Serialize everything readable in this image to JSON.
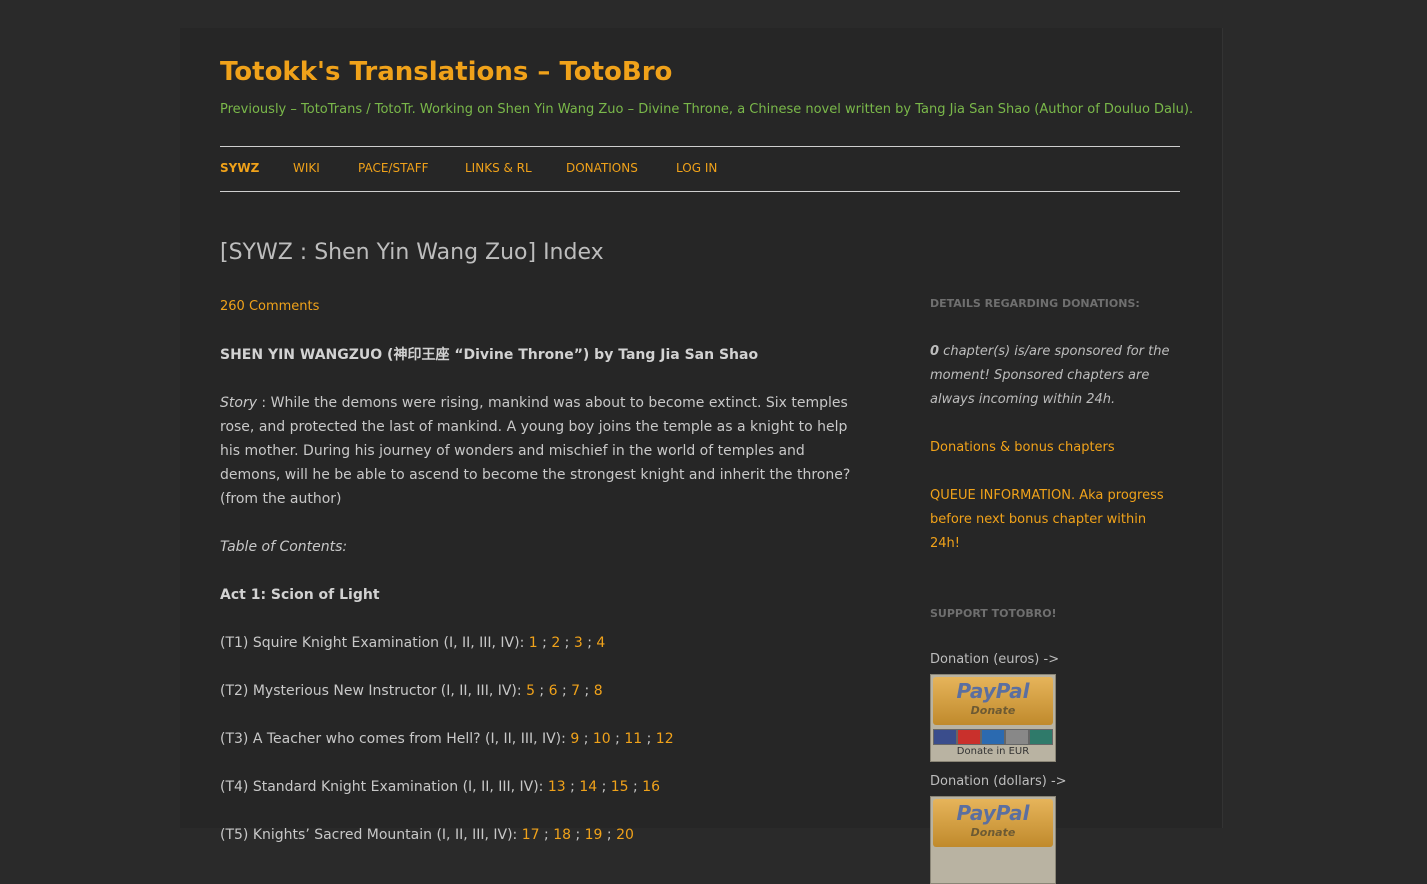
{
  "site": {
    "title": "Totokk's Translations – TotoBro",
    "tagline": "Previously – TotoTrans / TotoTr. Working on Shen Yin Wang Zuo – Divine Throne, a Chinese novel written by Tang Jia San Shao (Author of Douluo Dalu)."
  },
  "nav": [
    "SYWZ",
    "WIKI",
    "PACE/STAFF",
    "LINKS & RL",
    "DONATIONS",
    "LOG IN"
  ],
  "post": {
    "title": "[SYWZ : Shen Yin Wang Zuo] Index",
    "comments": "260 Comments",
    "heading": "SHEN YIN WANGZUO (神印王座 “Divine Throne”) by Tang Jia San Shao",
    "story_label": "Story",
    "story_text": " : While the demons were rising, mankind was about to become extinct. Six temples rose, and protected the last of mankind. A young boy joins the temple as a knight to help his mother. During his journey of wonders and mischief in the world of temples and demons, will he be able to ascend to become the strongest knight and inherit the throne? (from the author)",
    "toc_label": "Table of Contents:",
    "act_label": "Act 1: Scion of Light",
    "toc": [
      {
        "label": "(T1) Squire Knight Examination (I, II, III, IV): ",
        "chapters": [
          "1",
          "2",
          "3",
          "4"
        ]
      },
      {
        "label": "(T2) Mysterious New Instructor (I, II, III, IV): ",
        "chapters": [
          "5",
          "6",
          "7",
          "8"
        ]
      },
      {
        "label": "(T3) A Teacher who comes from Hell? (I, II, III, IV): ",
        "chapters": [
          "9",
          "10",
          "11",
          "12"
        ]
      },
      {
        "label": "(T4) Standard Knight Examination (I, II, III, IV): ",
        "chapters": [
          "13",
          "14",
          "15",
          "16"
        ]
      },
      {
        "label": "(T5) Knights’ Sacred Mountain (I, II, III, IV): ",
        "chapters": [
          "17",
          "18",
          "19",
          "20"
        ]
      }
    ]
  },
  "sidebar": {
    "donations_heading": "DETAILS REGARDING DONATIONS:",
    "sponsored_count": "0",
    "sponsored_text": " chapter(s) is/are sponsored for the moment! Sponsored chapters are always incoming within 24h.",
    "donations_link": "Donations & bonus chapters",
    "queue_link": "QUEUE INFORMATION. Aka progress before next bonus chapter within 24h!",
    "support_heading": "SUPPORT TOTOBRO!",
    "donation_euros": "Donation (euros) ->",
    "donation_dollars": "Donation (dollars) ->",
    "paypal_logo": "PayPal",
    "paypal_donate": "Donate",
    "paypal_caption_eur": "Donate in EUR"
  }
}
